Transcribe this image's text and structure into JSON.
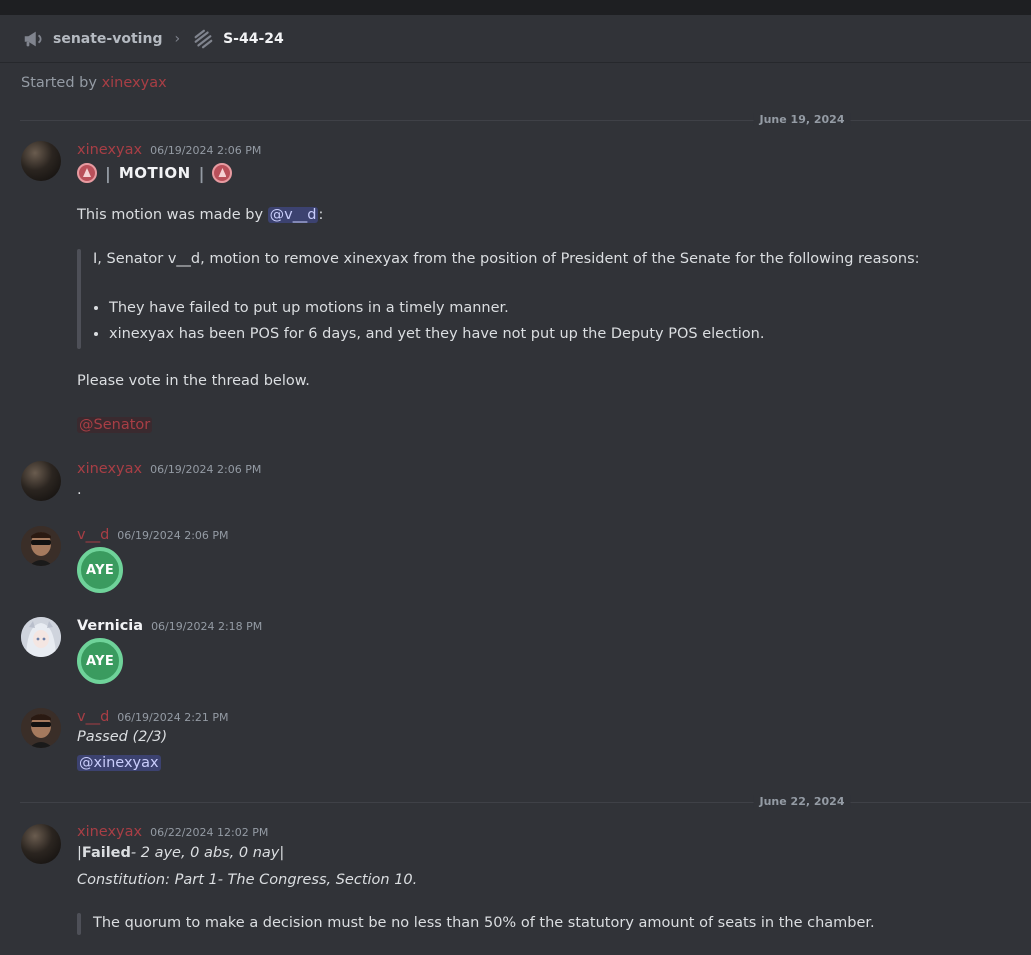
{
  "header": {
    "channel_name": "senate-voting",
    "chevron": "›",
    "thread_name": "S-44-24",
    "channel_icon": "megaphone-icon",
    "thread_icon": "thread-icon"
  },
  "thread_start": {
    "prefix": "Started by",
    "user": "xinexyax"
  },
  "dividers": [
    "June 19, 2024",
    "June 22, 2024"
  ],
  "messages": [
    {
      "author": "xinexyax",
      "timestamp": "06/19/2024 2:06 PM",
      "motion_label": "MOTION",
      "pipe": "|",
      "made_by_prefix": "This motion was made by",
      "made_by_mention": "@v__d",
      "made_by_suffix": ":",
      "quote": "I, Senator v__d, motion to remove xinexyax from the position of President of the Senate for the following reasons:",
      "reasons": [
        "They have failed to put up motions in a timely manner.",
        "xinexyax has been POS for 6 days, and yet they have not put up the Deputy POS election."
      ],
      "vote_prompt": "Please vote in the thread below.",
      "role_mention": "@Senator"
    },
    {
      "author": "xinexyax",
      "timestamp": "06/19/2024 2:06 PM",
      "text": "."
    },
    {
      "author": "v__d",
      "timestamp": "06/19/2024 2:06 PM",
      "emoji_text": "AYE"
    },
    {
      "author": "Vernicia",
      "timestamp": "06/19/2024 2:18 PM",
      "emoji_text": "AYE"
    },
    {
      "author": "v__d",
      "timestamp": "06/19/2024 2:21 PM",
      "text": "Passed (2/3)",
      "mention": "@xinexyax"
    },
    {
      "author": "xinexyax",
      "timestamp": "06/22/2024 12:02 PM",
      "pipe": "|",
      "failed_bold": "Failed",
      "failed_rest": "- 2 aye, 0 abs, 0 nay",
      "citation": "Constitution: Part 1- The Congress, Section 10.",
      "quote": "The quorum to make a decision must be no less than 50% of the statutory amount of seats in the chamber."
    }
  ],
  "colors": {
    "background": "#313338",
    "username_red": "#a83e45",
    "mention_bg": "#3c4270",
    "aye_green": "#3a9b5f"
  }
}
